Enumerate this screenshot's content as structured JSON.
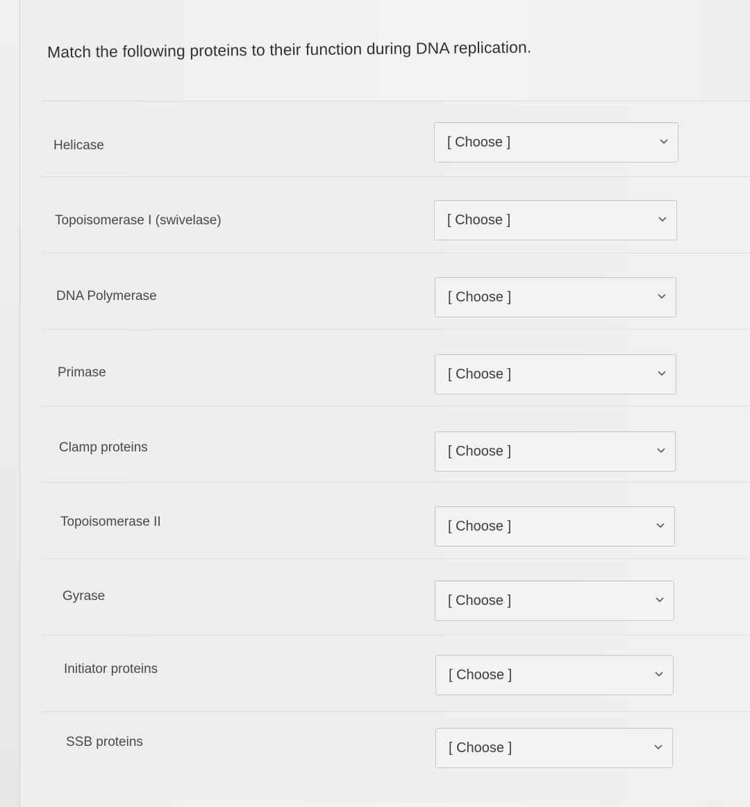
{
  "question": {
    "title": "Match the following proteins to their function during DNA replication."
  },
  "matches": [
    {
      "term": "Helicase",
      "selected": "[ Choose ]"
    },
    {
      "term": "Topoisomerase I (swivelase)",
      "selected": "[ Choose ]"
    },
    {
      "term": "DNA Polymerase",
      "selected": "[ Choose ]"
    },
    {
      "term": "Primase",
      "selected": "[ Choose ]"
    },
    {
      "term": "Clamp proteins",
      "selected": "[ Choose ]"
    },
    {
      "term": "Topoisomerase II",
      "selected": "[ Choose ]"
    },
    {
      "term": "Gyrase",
      "selected": "[ Choose ]"
    },
    {
      "term": "Initiator proteins",
      "selected": "[ Choose ]"
    },
    {
      "term": "SSB proteins",
      "selected": "[ Choose ]"
    }
  ],
  "icons": {
    "dropdown": "chevron-down-icon"
  },
  "colors": {
    "background": "#f0f0f1",
    "text": "#3b3d40",
    "select_border": "#c4c6c9"
  }
}
